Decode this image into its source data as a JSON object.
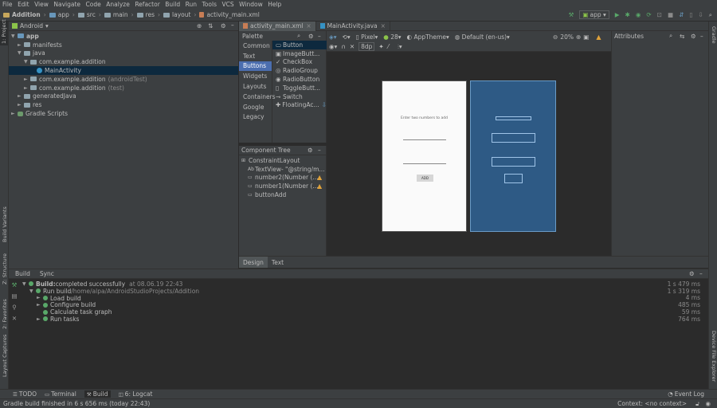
{
  "menu": [
    "File",
    "Edit",
    "View",
    "Navigate",
    "Code",
    "Analyze",
    "Refactor",
    "Build",
    "Run",
    "Tools",
    "VCS",
    "Window",
    "Help"
  ],
  "breadcrumb": [
    "Addition",
    "app",
    "src",
    "main",
    "res",
    "layout",
    "activity_main.xml"
  ],
  "run_config": "app",
  "project_panel": {
    "view": "Android",
    "tree": [
      {
        "label": "app",
        "muted": "",
        "indent": 0,
        "arrow": "▼",
        "icon": "folder-blue"
      },
      {
        "label": "manifests",
        "muted": "",
        "indent": 1,
        "arrow": "►",
        "icon": "folder"
      },
      {
        "label": "java",
        "muted": "",
        "indent": 1,
        "arrow": "▼",
        "icon": "folder"
      },
      {
        "label": "com.example.addition",
        "muted": "",
        "indent": 2,
        "arrow": "▼",
        "icon": "folder"
      },
      {
        "label": "MainActivity",
        "muted": "",
        "indent": 3,
        "arrow": "",
        "icon": "class",
        "selected": true
      },
      {
        "label": "com.example.addition",
        "muted": "(androidTest)",
        "indent": 2,
        "arrow": "►",
        "icon": "folder"
      },
      {
        "label": "com.example.addition",
        "muted": "(test)",
        "indent": 2,
        "arrow": "►",
        "icon": "folder"
      },
      {
        "label": "generatedJava",
        "muted": "",
        "indent": 1,
        "arrow": "►",
        "icon": "folder"
      },
      {
        "label": "res",
        "muted": "",
        "indent": 1,
        "arrow": "►",
        "icon": "folder"
      },
      {
        "label": "Gradle Scripts",
        "muted": "",
        "indent": 0,
        "arrow": "►",
        "icon": "gradle"
      }
    ]
  },
  "left_strip": {
    "project": "1: Project",
    "build_variants": "Build Variants",
    "structure": "Z: Structure",
    "favorites": "2: Favorites",
    "captures": "Layout Captures"
  },
  "right_strip": {
    "gradle": "Gradle",
    "device_explorer": "Device File Explorer"
  },
  "editor_tabs": [
    {
      "label": "activity_main.xml",
      "active": true
    },
    {
      "label": "MainActivity.java",
      "active": false
    }
  ],
  "palette": {
    "title": "Palette",
    "categories": [
      "Common",
      "Text",
      "Buttons",
      "Widgets",
      "Layouts",
      "Containers",
      "Google",
      "Legacy"
    ],
    "selected_category": "Buttons",
    "items": [
      "Button",
      "ImageButt...",
      "CheckBox",
      "RadioGroup",
      "RadioButton",
      "ToggleButt...",
      "Switch",
      "FloatingAc..."
    ]
  },
  "component_tree": {
    "title": "Component Tree",
    "items": [
      {
        "label": "ConstraintLayout",
        "indent": 0,
        "warn": false
      },
      {
        "label": "TextView- \"@string/m...",
        "indent": 1,
        "warn": false
      },
      {
        "label": "number2(Number (...",
        "indent": 1,
        "warn": true
      },
      {
        "label": "number1(Number (...",
        "indent": 1,
        "warn": true
      },
      {
        "label": "buttonAdd",
        "indent": 1,
        "warn": false
      }
    ]
  },
  "design_toolbar": {
    "device": "Pixel",
    "api": "28",
    "theme": "AppTheme",
    "locale": "Default (en-us)",
    "zoom": "20%",
    "margin": "8dp"
  },
  "attributes_title": "Attributes",
  "phone_preview": {
    "prompt": "Enter two numbers to add",
    "button": "ADD"
  },
  "design_tabs": {
    "design": "Design",
    "text": "Text"
  },
  "build_panel": {
    "tabs": [
      "Build",
      "Sync"
    ],
    "rows": [
      {
        "label": "Build:",
        "rest": " completed successfully",
        "ts": "at 08.06.19 22:43",
        "time": "1 s 479 ms",
        "indent": 0,
        "arrow": "▼",
        "bold": true
      },
      {
        "label": "Run build",
        "rest": " /home/alpa/AndroidStudioProjects/Addition",
        "ts": "",
        "time": "1 s 319 ms",
        "indent": 1,
        "arrow": "▼",
        "bold": false
      },
      {
        "label": "Load build",
        "rest": "",
        "ts": "",
        "time": "4 ms",
        "indent": 2,
        "arrow": "►",
        "bold": false
      },
      {
        "label": "Configure build",
        "rest": "",
        "ts": "",
        "time": "485 ms",
        "indent": 2,
        "arrow": "►",
        "bold": false
      },
      {
        "label": "Calculate task graph",
        "rest": "",
        "ts": "",
        "time": "59 ms",
        "indent": 2,
        "arrow": "",
        "bold": false
      },
      {
        "label": "Run tasks",
        "rest": "",
        "ts": "",
        "time": "764 ms",
        "indent": 2,
        "arrow": "►",
        "bold": false
      }
    ]
  },
  "bottom_tabs": [
    "TODO",
    "Terminal",
    "Build",
    "6: Logcat"
  ],
  "event_log": "Event Log",
  "status": "Gradle build finished in 6 s 656 ms (today 22:43)",
  "context": "Context: <no context>",
  "colors": {
    "bg": "#2b2b2b",
    "panel": "#3c3f41",
    "selection": "#0d293e",
    "accent": "#4b6eaf",
    "blueprint": "#2e5a85",
    "success": "#59a869"
  }
}
